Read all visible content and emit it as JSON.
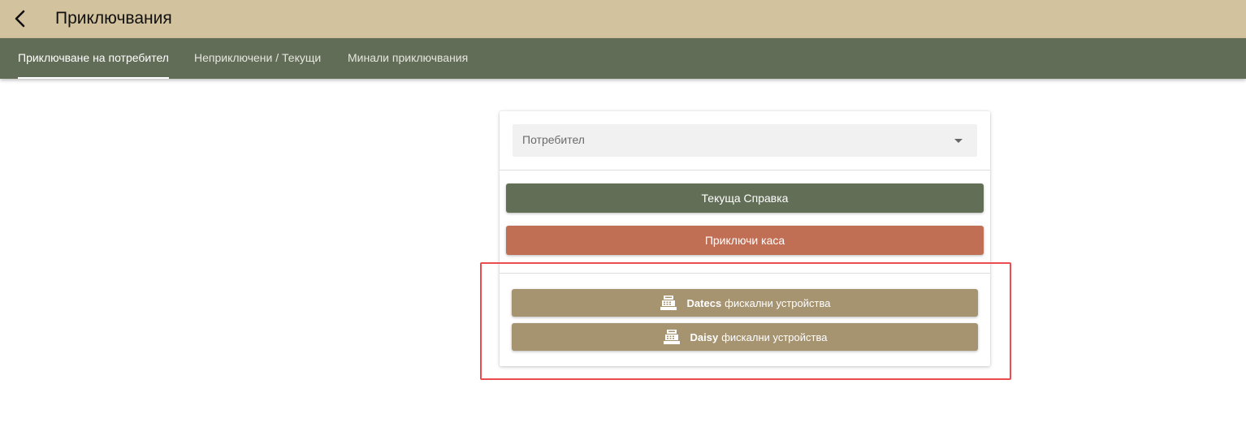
{
  "header": {
    "title": "Приключвания",
    "back_icon": "chevron-left-icon"
  },
  "tabs": [
    {
      "label": "Приключване на потребител",
      "active": true
    },
    {
      "label": "Неприключени / Текущи",
      "active": false
    },
    {
      "label": "Минали приключвания",
      "active": false
    }
  ],
  "form": {
    "user_select": {
      "placeholder": "Потребител",
      "value": ""
    },
    "current_report_label": "Текуща Справка",
    "close_register_label": "Приключи каса",
    "fiscal_devices": [
      {
        "brand": "Datecs",
        "label": "фискални устройства",
        "icon": "cash-register-icon"
      },
      {
        "brand": "Daisy",
        "label": "фискални устройства",
        "icon": "cash-register-icon"
      }
    ]
  },
  "colors": {
    "header_bg": "#d2c29d",
    "tabbar_bg": "#626d57",
    "report_button": "#636e57",
    "close_button": "#c06f55",
    "fiscal_button": "#a69370",
    "highlight_border": "#ea4c4f"
  }
}
